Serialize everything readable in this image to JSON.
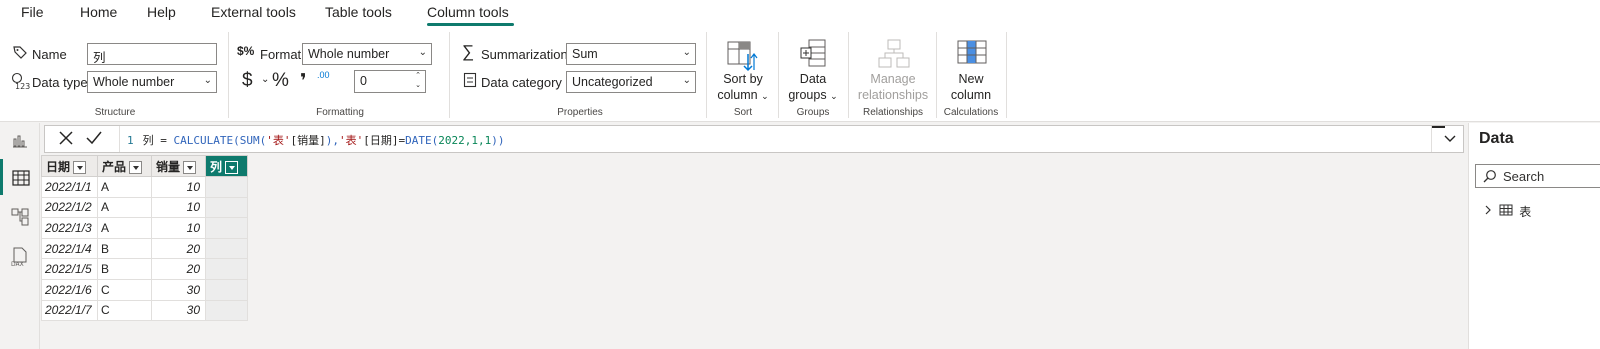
{
  "menu": {
    "items": [
      "File",
      "Home",
      "Help",
      "External tools",
      "Table tools",
      "Column tools"
    ],
    "active": "Column tools"
  },
  "structure": {
    "name_label": "Name",
    "name_value": "列",
    "datatype_label": "Data type",
    "datatype_value": "Whole number",
    "group_label": "Structure"
  },
  "formatting": {
    "format_label": "Format",
    "format_value": "Whole number",
    "currency_symbol": "$",
    "percent_symbol": "%",
    "comma_symbol": "❜",
    "decimals_symbol": ".00",
    "decimals_value": "0",
    "group_label": "Formatting"
  },
  "properties": {
    "summarization_label": "Summarization",
    "summarization_value": "Sum",
    "category_label": "Data category",
    "category_value": "Uncategorized",
    "group_label": "Properties"
  },
  "sort": {
    "line1": "Sort by",
    "line2": "column",
    "group_label": "Sort"
  },
  "groups": {
    "line1": "Data",
    "line2": "groups",
    "group_label": "Groups"
  },
  "relationships": {
    "line1": "Manage",
    "line2": "relationships",
    "group_label": "Relationships"
  },
  "calculations": {
    "line1": "New",
    "line2": "column",
    "group_label": "Calculations"
  },
  "formula": {
    "line_no": "1",
    "col": "列",
    "eq": " = ",
    "fn1": "CALCULATE(SUM(",
    "tbl1": "'表'",
    "col1": "[销量]",
    "mid": "),",
    "tbl2": "'表'",
    "col2": "[日期]",
    "eq2": "=",
    "fn2": "DATE(",
    "args": "2022,1,1",
    "close": "))"
  },
  "table": {
    "headers": [
      "日期",
      "产品",
      "销量",
      "列"
    ],
    "rows": [
      [
        "2022/1/1",
        "A",
        "10",
        ""
      ],
      [
        "2022/1/2",
        "A",
        "10",
        ""
      ],
      [
        "2022/1/3",
        "A",
        "10",
        ""
      ],
      [
        "2022/1/4",
        "B",
        "20",
        ""
      ],
      [
        "2022/1/5",
        "B",
        "20",
        ""
      ],
      [
        "2022/1/6",
        "C",
        "30",
        ""
      ],
      [
        "2022/1/7",
        "C",
        "30",
        ""
      ]
    ]
  },
  "data_panel": {
    "title": "Data",
    "search_placeholder": "Search",
    "tree_item": "表"
  },
  "colors": {
    "accent": "#0e7a6d",
    "dax_function": "#3165bb",
    "dax_string": "#a31515"
  }
}
